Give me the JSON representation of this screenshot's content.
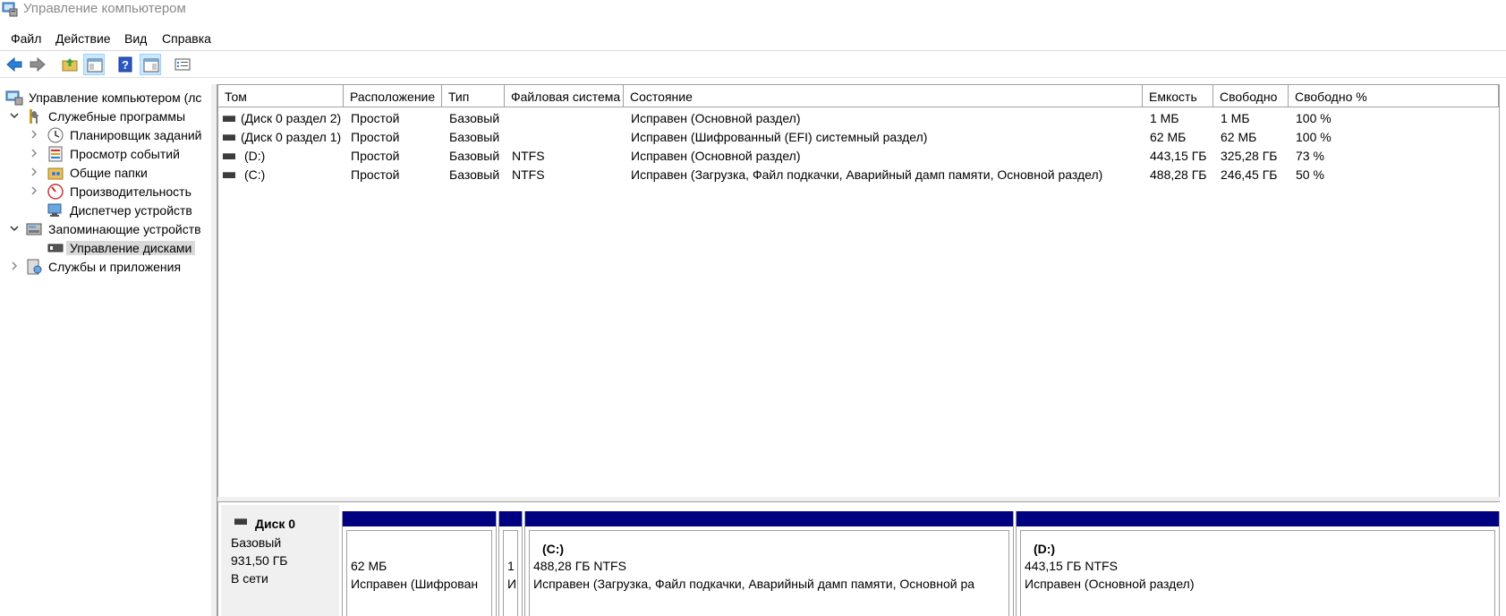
{
  "window": {
    "title": "Управление компьютером"
  },
  "menu": [
    "Файл",
    "Действие",
    "Вид",
    "Справка"
  ],
  "toolbar": {
    "buttons": [
      "back-arrow-icon",
      "forward-arrow-icon",
      "up-folder-icon",
      "show-hide-console-tree-icon",
      "help-icon",
      "show-hide-action-pane-icon",
      "properties-icon"
    ]
  },
  "tree": {
    "root": "Управление компьютером (лс",
    "items": [
      {
        "label": "Служебные программы",
        "icon": "tools-icon"
      },
      {
        "label": "Планировщик заданий",
        "icon": "clock-icon"
      },
      {
        "label": "Просмотр событий",
        "icon": "event-viewer-icon"
      },
      {
        "label": "Общие папки",
        "icon": "shared-folder-icon"
      },
      {
        "label": "Производительность",
        "icon": "performance-icon"
      },
      {
        "label": "Диспетчер устройств",
        "icon": "device-manager-icon"
      },
      {
        "label": "Запоминающие устройств",
        "icon": "storage-icon"
      },
      {
        "label": "Управление дисками",
        "icon": "disk-management-icon"
      },
      {
        "label": "Службы и приложения",
        "icon": "services-icon"
      }
    ]
  },
  "volumes": {
    "columns": [
      "Том",
      "Расположение",
      "Тип",
      "Файловая система",
      "Состояние",
      "Емкость",
      "Свободно",
      "Свободно %"
    ],
    "rows": [
      [
        "(Диск 0 раздел 2)",
        "Простой",
        "Базовый",
        "",
        "Исправен (Основной раздел)",
        "1 МБ",
        "1 МБ",
        "100 %"
      ],
      [
        "(Диск 0 раздел 1)",
        "Простой",
        "Базовый",
        "",
        "Исправен (Шифрованный (EFI) системный раздел)",
        "62 МБ",
        "62 МБ",
        "100 %"
      ],
      [
        "(D:)",
        "Простой",
        "Базовый",
        "NTFS",
        "Исправен (Основной раздел)",
        "443,15 ГБ",
        "325,28 ГБ",
        "73 %"
      ],
      [
        "(C:)",
        "Простой",
        "Базовый",
        "NTFS",
        "Исправен (Загрузка, Файл подкачки, Аварийный дамп памяти, Основной раздел)",
        "488,28 ГБ",
        "246,45 ГБ",
        "50 %"
      ]
    ]
  },
  "disk": {
    "name": "Диск 0",
    "type": "Базовый",
    "size": "931,50 ГБ",
    "status": "В сети",
    "partitions": [
      {
        "name": "",
        "size": "62 МБ",
        "status": "Исправен (Шифрован"
      },
      {
        "name": "",
        "size": "1",
        "status": "И"
      },
      {
        "name": "(C:)",
        "size": "488,28 ГБ NTFS",
        "status": "Исправен (Загрузка, Файл подкачки, Аварийный дамп памяти, Основной ра"
      },
      {
        "name": "(D:)",
        "size": "443,15 ГБ NTFS",
        "status": "Исправен (Основной раздел)"
      }
    ]
  },
  "colors": {
    "partition_header": "#000080",
    "selection": "#d9d9d9",
    "toolbar_active": "#cce8ff"
  }
}
